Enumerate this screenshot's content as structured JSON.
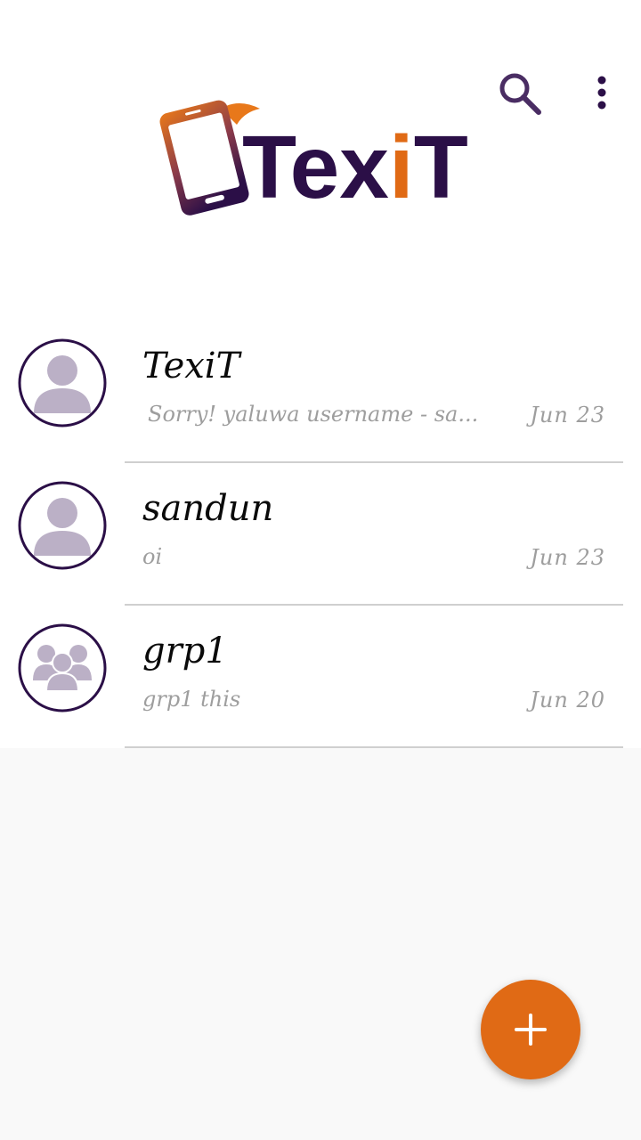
{
  "app": {
    "logo_text_main": "Tex",
    "logo_text_i": "i",
    "logo_text_end": "T"
  },
  "toolbar": {
    "search_icon": "search-icon",
    "more_icon": "more-vert-icon"
  },
  "chats": [
    {
      "name": "TexiT",
      "preview": "Sorry! yaluwa username - sa...",
      "date": "Jun  23",
      "avatar": "person-icon"
    },
    {
      "name": "sandun",
      "preview": "oi",
      "date": "Jun  23",
      "avatar": "person-icon"
    },
    {
      "name": "grp1",
      "preview": "grp1 this",
      "date": "Jun  20",
      "avatar": "group-icon"
    }
  ],
  "fab": {
    "icon": "plus-icon"
  },
  "colors": {
    "brand_purple": "#2b0f47",
    "brand_orange": "#e06a15",
    "avatar_fill": "#bbb0c6"
  }
}
